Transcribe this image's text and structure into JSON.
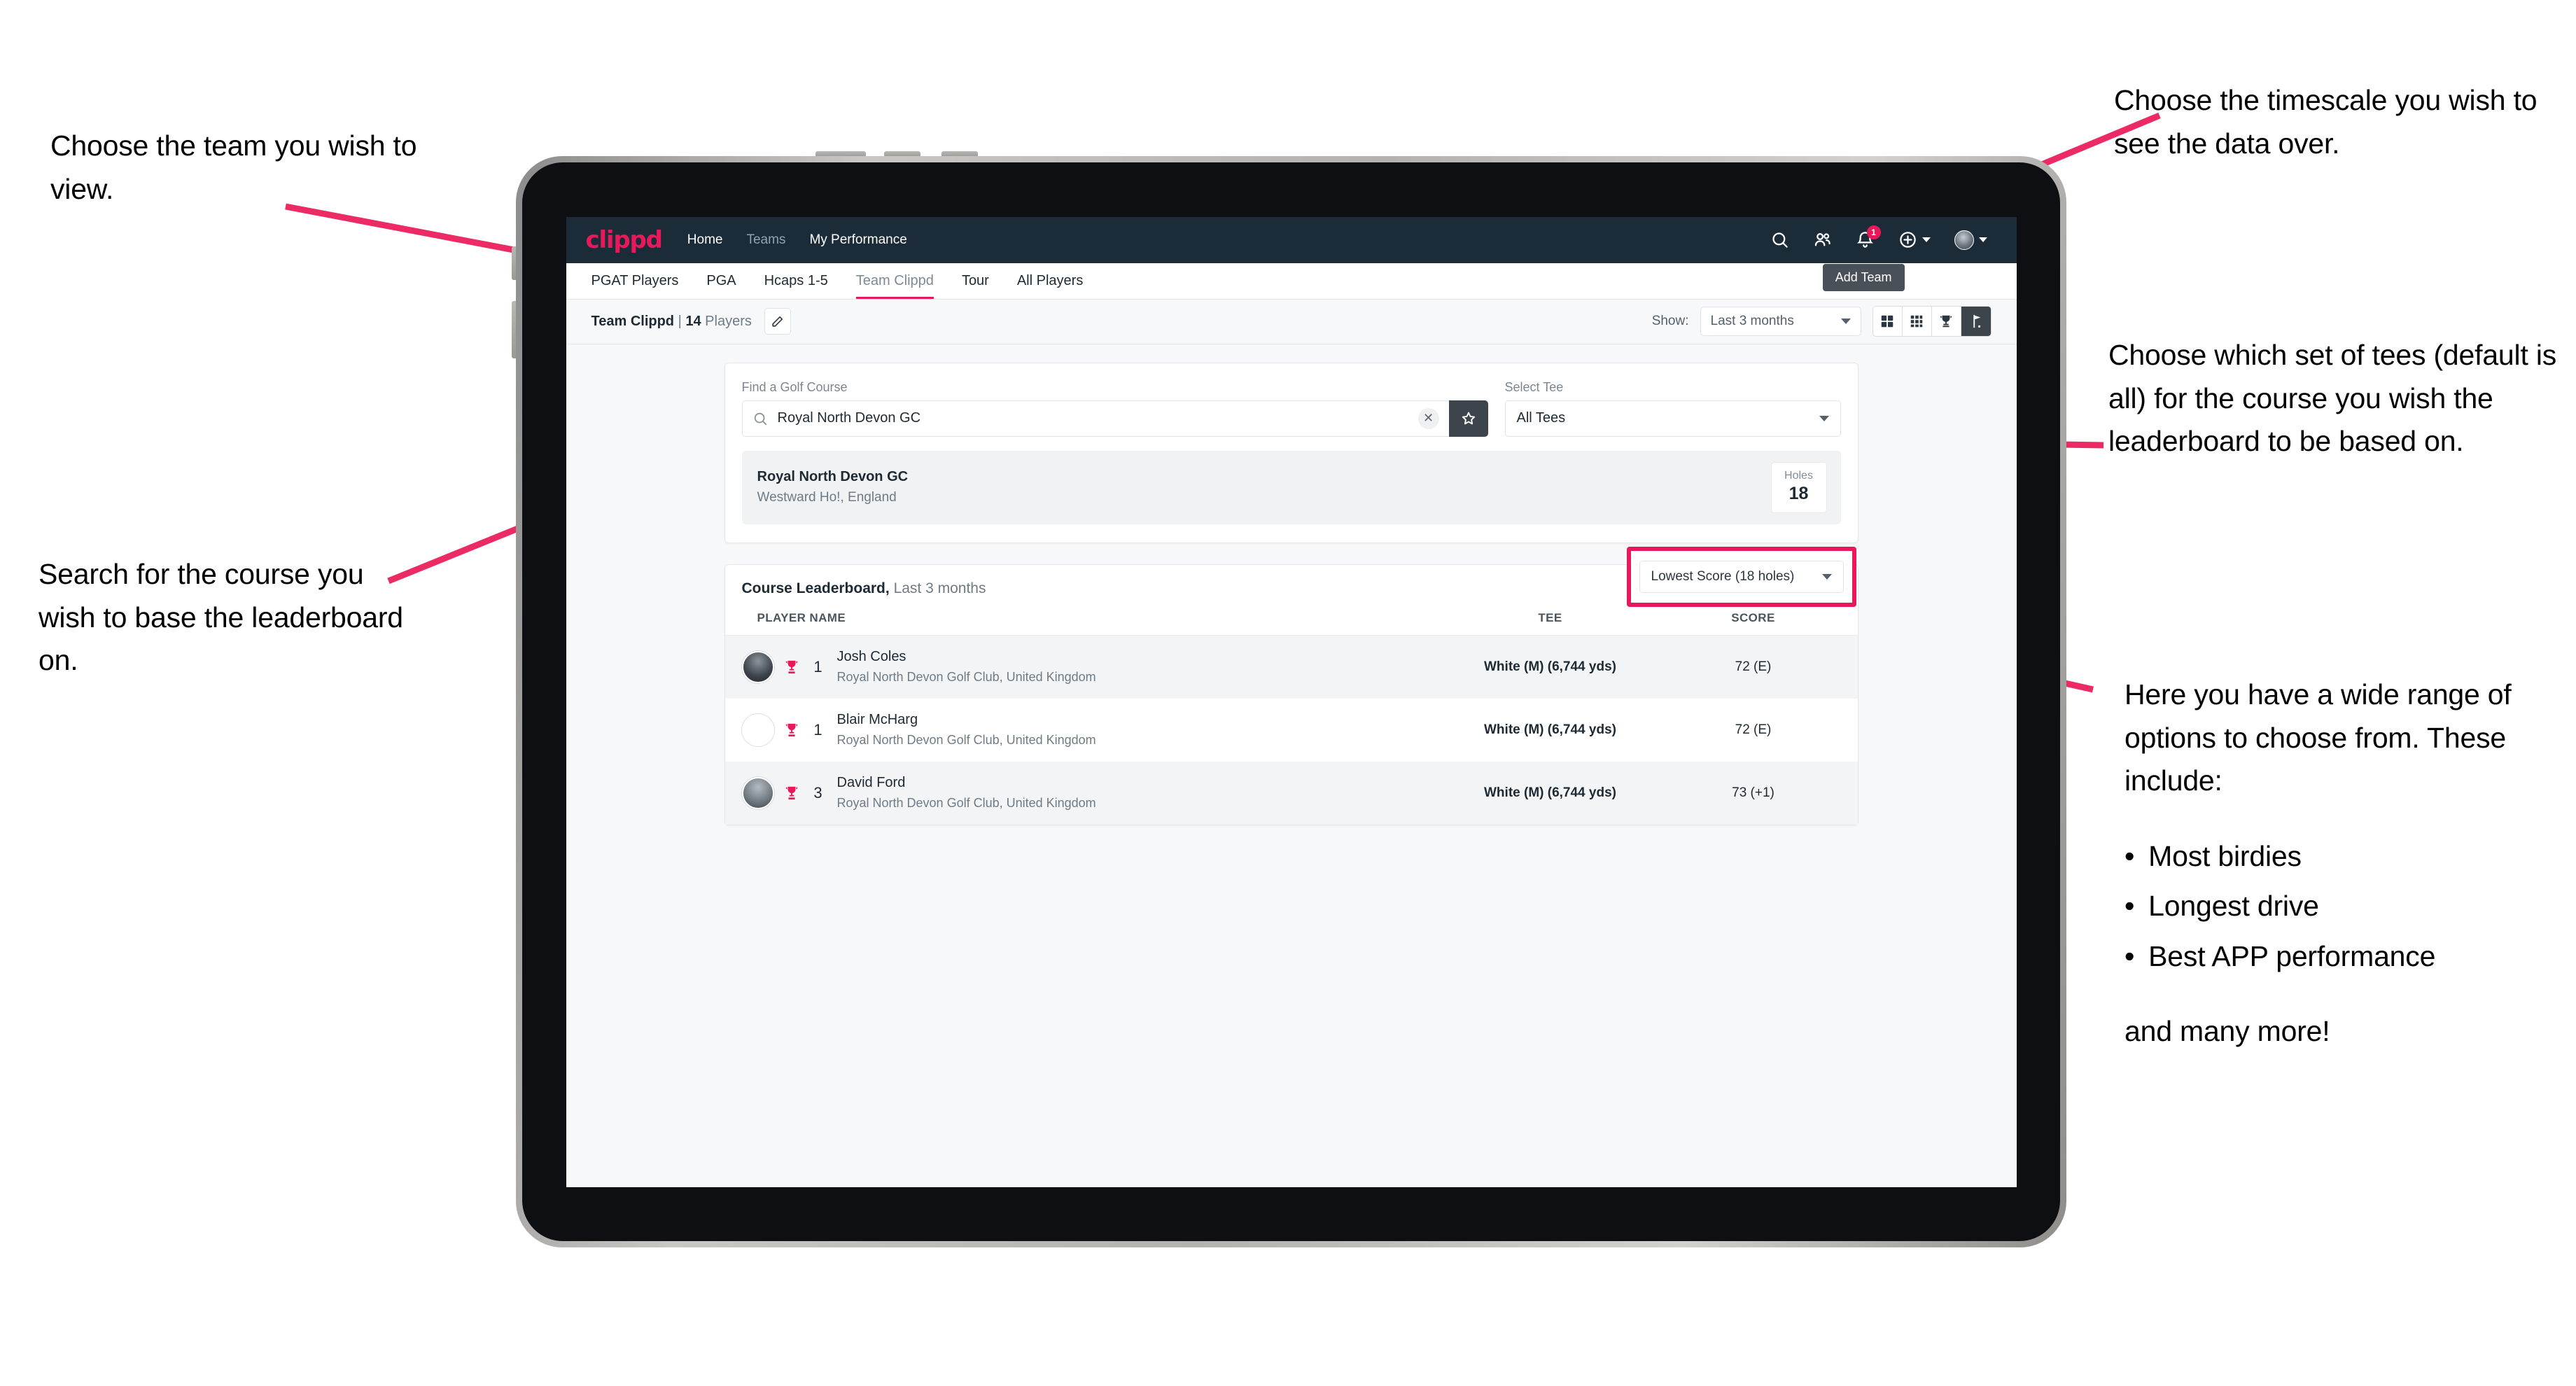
{
  "annotations": {
    "team": "Choose the team you wish to view.",
    "timescale": "Choose the timescale you wish to see the data over.",
    "tees": "Choose which set of tees (default is all) for the course you wish the leaderboard to be based on.",
    "search": "Search for the course you wish to base the leaderboard on.",
    "options_intro": "Here you have a wide range of options to choose from. These include:",
    "options_bullets": [
      "Most birdies",
      "Longest drive",
      "Best APP performance"
    ],
    "options_tail": "and many more!"
  },
  "navbar": {
    "brand": "clippd",
    "links": [
      {
        "label": "Home",
        "dim": false
      },
      {
        "label": "Teams",
        "dim": true
      },
      {
        "label": "My Performance",
        "dim": false
      }
    ],
    "icons": [
      "search-icon",
      "people-icon",
      "bell-icon",
      "plus-circle-icon",
      "avatar-icon"
    ],
    "notification_count": "1"
  },
  "tabs": {
    "items": [
      "PGAT Players",
      "PGA",
      "Hcaps 1-5",
      "Team Clippd",
      "Tour",
      "All Players"
    ],
    "active": "Team Clippd",
    "tooltip": "Add Team"
  },
  "toolbar": {
    "team_name": "Team Clippd",
    "separator": "|",
    "player_count": "14",
    "players_word": "Players",
    "edit_icon": "pencil-icon",
    "show_label": "Show:",
    "show_value": "Last 3 months",
    "views": [
      {
        "name": "grid-2x2-view",
        "active": false
      },
      {
        "name": "grid-3x3-view",
        "active": false
      },
      {
        "name": "trophy-view",
        "active": false
      },
      {
        "name": "golf-flag-view",
        "active": true
      }
    ]
  },
  "search_card": {
    "course_label": "Find a Golf Course",
    "course_value": "Royal North Devon GC",
    "course_placeholder": "Find a Golf Course",
    "clear_icon": "close-icon",
    "star_icon": "star-icon",
    "tee_label": "Select Tee",
    "tee_value": "All Tees"
  },
  "course_result": {
    "name": "Royal North Devon GC",
    "location": "Westward Ho!, England",
    "holes_label": "Holes",
    "holes_value": "18"
  },
  "leaderboard": {
    "title": "Course Leaderboard,",
    "subtitle": "Last 3 months",
    "metric_value": "Lowest Score (18 holes)",
    "columns": [
      "PLAYER NAME",
      "TEE",
      "SCORE"
    ],
    "rows": [
      {
        "rank": "1",
        "name": "Josh Coles",
        "club": "Royal North Devon Golf Club, United Kingdom",
        "tee": "White (M) (6,744 yds)",
        "score": "72 (E)"
      },
      {
        "rank": "1",
        "name": "Blair McHarg",
        "club": "Royal North Devon Golf Club, United Kingdom",
        "tee": "White (M) (6,744 yds)",
        "score": "72 (E)"
      },
      {
        "rank": "3",
        "name": "David Ford",
        "club": "Royal North Devon Golf Club, United Kingdom",
        "tee": "White (M) (6,744 yds)",
        "score": "73 (+1)"
      }
    ]
  },
  "colors": {
    "accent_pink": "#e8195b",
    "navbar_dark": "#1b2b38",
    "toggle_active": "#3e444c",
    "page_bg": "#f7f8fa"
  }
}
